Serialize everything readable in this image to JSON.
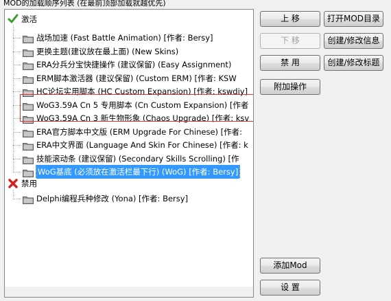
{
  "window": {
    "group_title": "MOD的加载顺序列表 (在最前顶部加载就越优先)"
  },
  "tree": {
    "categories": {
      "active": {
        "label": "激活",
        "icon": "green-check-icon"
      },
      "disabled": {
        "label": "禁用",
        "icon": "red-x-icon"
      }
    },
    "active_items": [
      "战场加速 (Fast Battle Animation) [作者: Bersy]",
      "更换主题(建议放在最上面) (New Skins)",
      "ERA分兵分宝快捷操作 (建议保留) (Easy Assignment)",
      "ERM脚本激活器 (建议保留) (Custom ERM) [作者: KSW",
      "HC论坛实用脚本 (HC Custom Expansion) [作者: kswdiy]",
      "WoG3.59A Cn 5 专用脚本 (Cn Custom Expansion) [作者",
      "WoG3.59A Cn 3 新生物形象 (Chaos Upgrade) [作者: ksv",
      "ERA官方脚本中文版 (ERM Upgrade For Chinese) [作者:",
      "ERA中文界面 (Language And Skin For Chinese) [作者: k",
      "技能滚动条 (建议保留) (Secondary Skills Scrolling) [作",
      "WoG基底 (必须放在激活栏最下行) (WoG) [作者: Bersy]"
    ],
    "disabled_items": [
      "Delphi编程兵种修改 (Yona) [作者: Bersy]"
    ],
    "selected_index": 10
  },
  "buttons": {
    "move_up": "上 移",
    "move_down": "下 移",
    "disable": "禁 用",
    "extra_ops": "附加操作",
    "open_dir": "打开MOD目录",
    "edit_info": "创建/修改信息",
    "edit_title": "创建/修改标题",
    "add_mod": "添加Mod",
    "settings": "设 置"
  },
  "colors": {
    "selection": "#3399ff",
    "highlight_frame": "#e03030"
  }
}
